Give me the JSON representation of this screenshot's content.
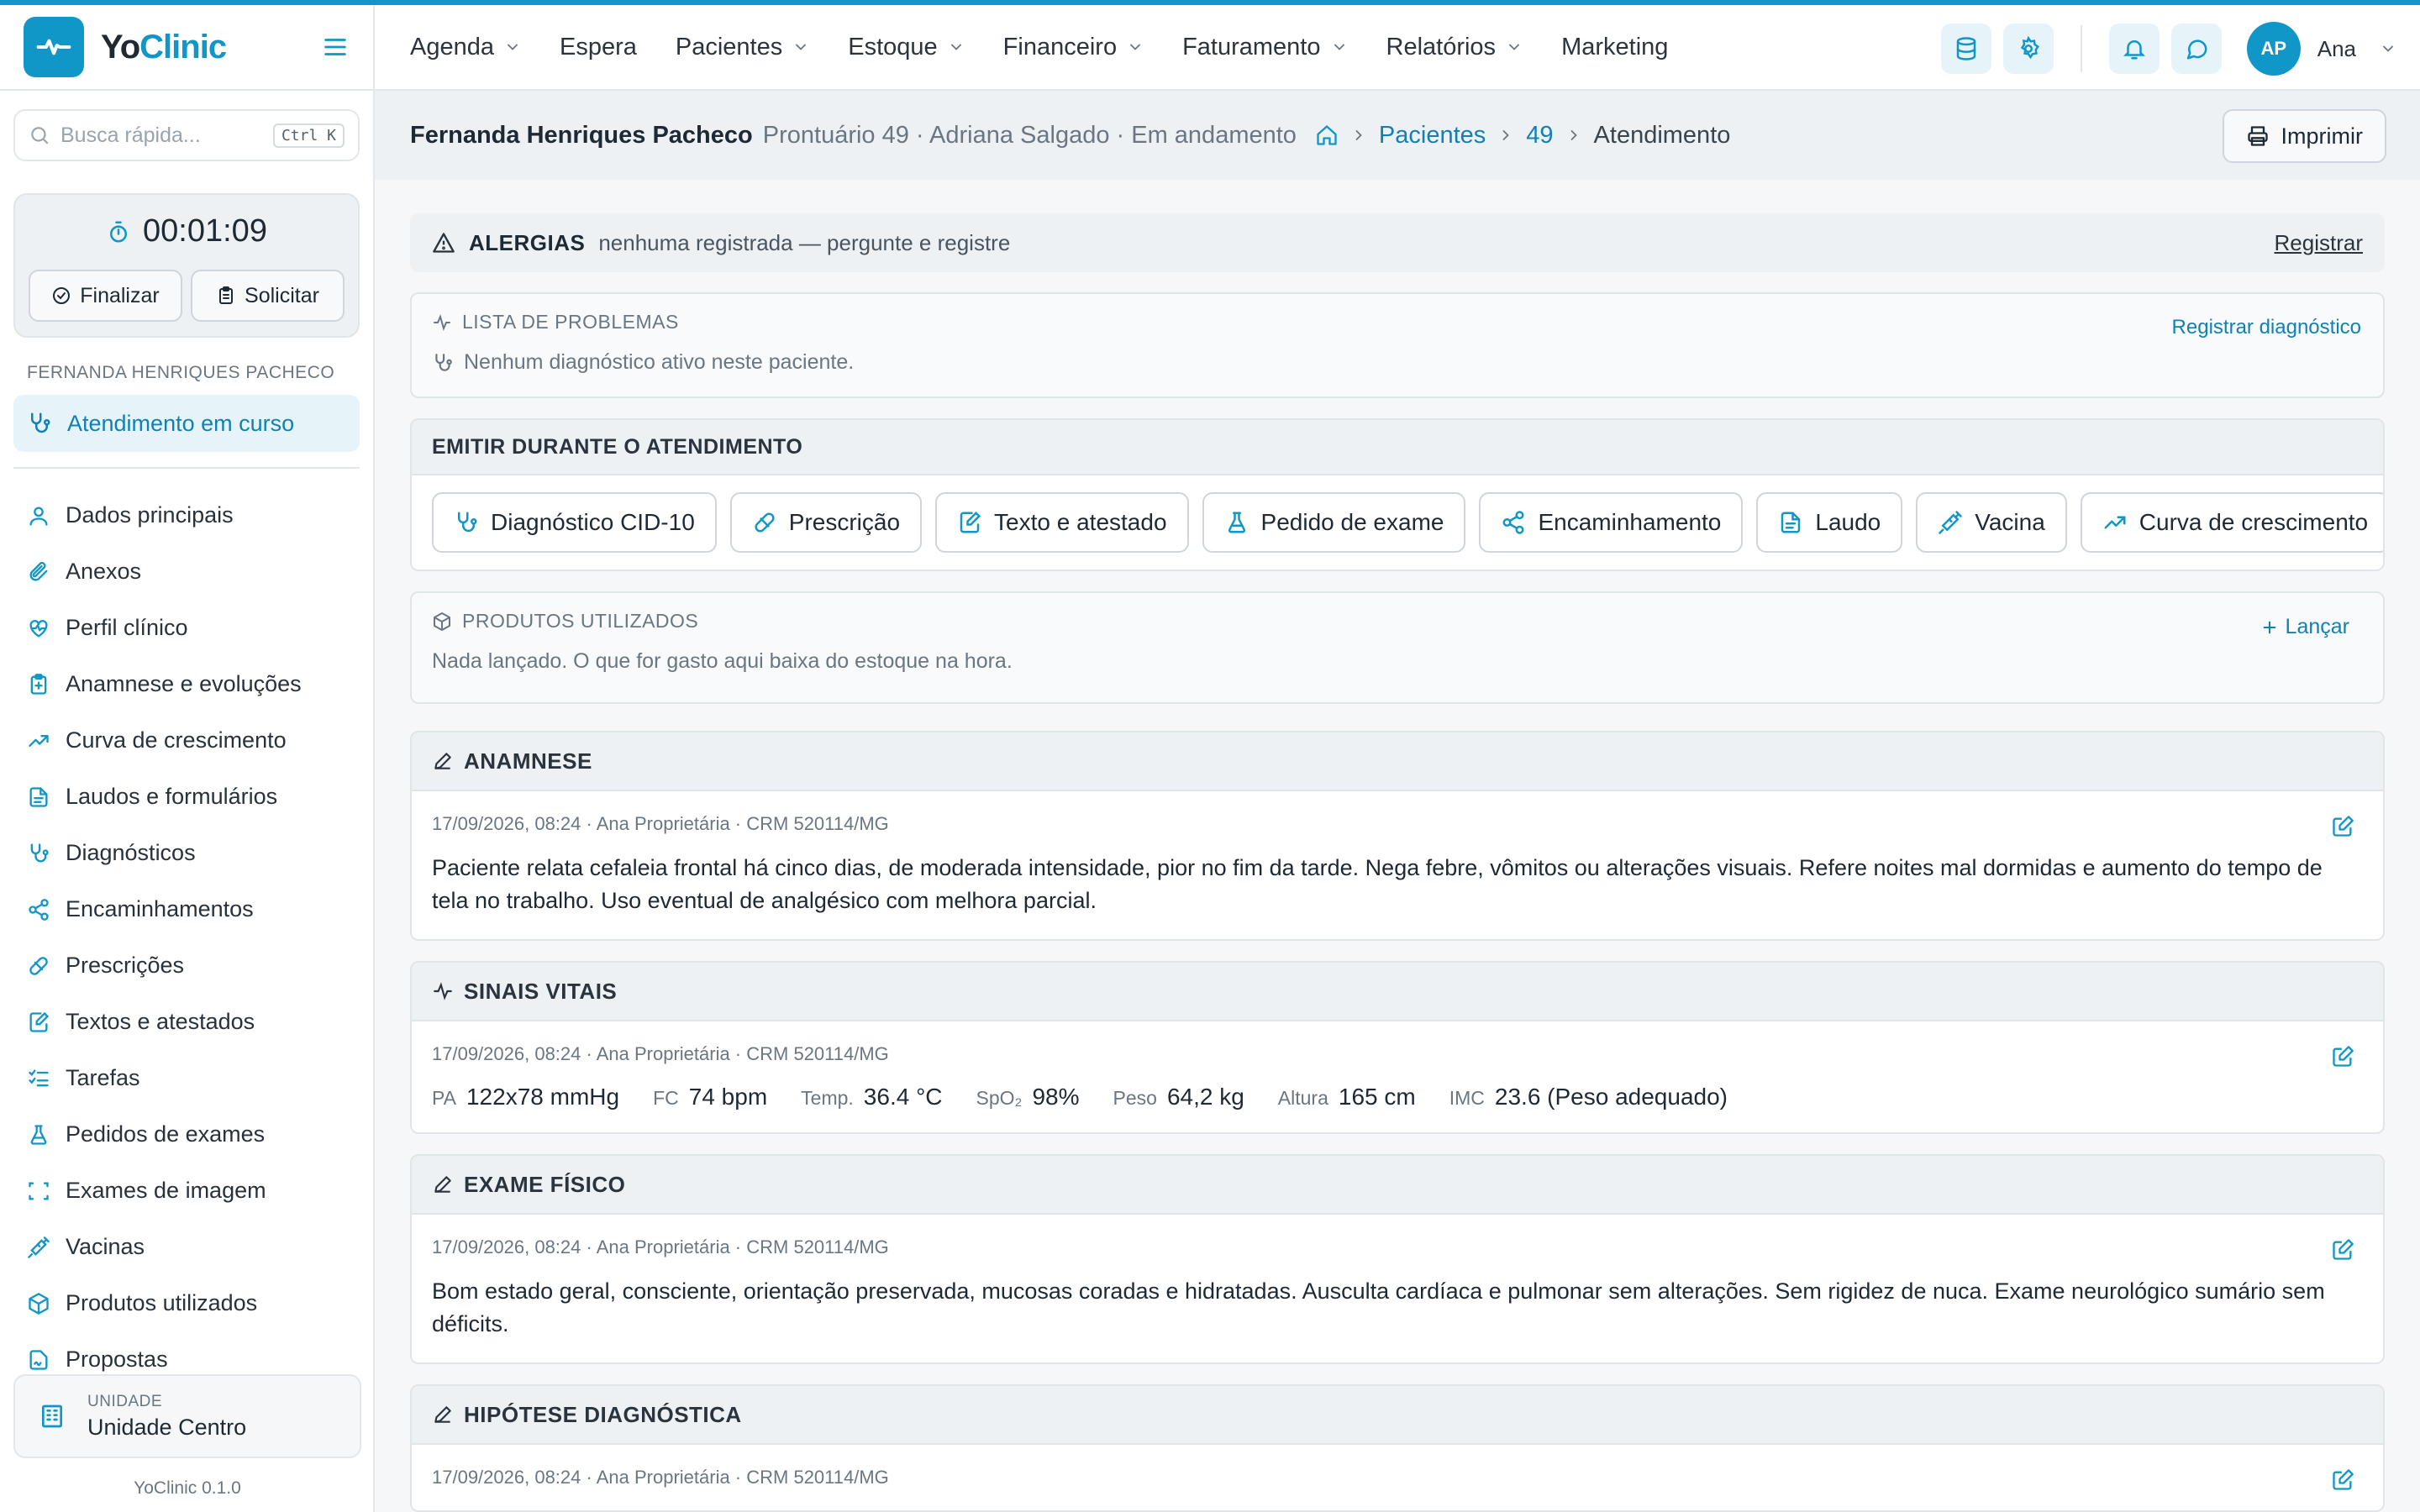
{
  "app": {
    "name_prefix": "Yo",
    "name_suffix": "Clinic",
    "version": "YoClinic 0.1.0"
  },
  "search": {
    "placeholder": "Busca rápida...",
    "shortcut": "Ctrl K"
  },
  "timer": {
    "value": "00:01:09",
    "finish_label": "Finalizar",
    "request_label": "Solicitar"
  },
  "sidebar": {
    "patient_label": "FERNANDA HENRIQUES PACHECO",
    "current_label": "Atendimento em curso",
    "items": [
      {
        "label": "Dados principais",
        "icon": "user-icon"
      },
      {
        "label": "Anexos",
        "icon": "paperclip-icon"
      },
      {
        "label": "Perfil clínico",
        "icon": "heart-pulse-icon"
      },
      {
        "label": "Anamnese e evoluções",
        "icon": "clipboard-plus-icon"
      },
      {
        "label": "Curva de crescimento",
        "icon": "trending-up-icon"
      },
      {
        "label": "Laudos e formulários",
        "icon": "file-text-icon"
      },
      {
        "label": "Diagnósticos",
        "icon": "stethoscope-icon"
      },
      {
        "label": "Encaminhamentos",
        "icon": "share-icon"
      },
      {
        "label": "Prescrições",
        "icon": "pill-icon"
      },
      {
        "label": "Textos e atestados",
        "icon": "file-edit-icon"
      },
      {
        "label": "Tarefas",
        "icon": "list-checks-icon"
      },
      {
        "label": "Pedidos de exames",
        "icon": "flask-icon"
      },
      {
        "label": "Exames de imagem",
        "icon": "scan-icon"
      },
      {
        "label": "Vacinas",
        "icon": "syringe-icon"
      },
      {
        "label": "Produtos utilizados",
        "icon": "package-icon"
      },
      {
        "label": "Propostas",
        "icon": "file-signature-icon"
      }
    ],
    "unit_label": "UNIDADE",
    "unit_value": "Unidade Centro"
  },
  "topnav": {
    "items": [
      {
        "label": "Agenda"
      },
      {
        "label": "Espera"
      },
      {
        "label": "Pacientes"
      },
      {
        "label": "Estoque"
      },
      {
        "label": "Financeiro"
      },
      {
        "label": "Faturamento"
      },
      {
        "label": "Relatórios"
      },
      {
        "label": "Marketing"
      }
    ],
    "avatar_initials": "AP",
    "user_name": "Ana"
  },
  "header": {
    "patient_name": "Fernanda Henriques Pacheco",
    "meta": "Prontuário 49 · Adriana Salgado · Em andamento",
    "crumbs": {
      "patients": "Pacientes",
      "id": "49",
      "current": "Atendimento"
    },
    "print_label": "Imprimir"
  },
  "allergies": {
    "title": "ALERGIAS",
    "message": "nenhuma registrada — pergunte e registre",
    "action": "Registrar"
  },
  "problems": {
    "title": "LISTA DE PROBLEMAS",
    "empty": "Nenhum diagnóstico ativo neste paciente.",
    "action": "Registrar diagnóstico"
  },
  "emit": {
    "title": "EMITIR DURANTE O ATENDIMENTO",
    "buttons": [
      {
        "label": "Diagnóstico CID-10"
      },
      {
        "label": "Prescrição"
      },
      {
        "label": "Texto e atestado"
      },
      {
        "label": "Pedido de exame"
      },
      {
        "label": "Encaminhamento"
      },
      {
        "label": "Laudo"
      },
      {
        "label": "Vacina"
      },
      {
        "label": "Curva de crescimento"
      }
    ]
  },
  "products": {
    "title": "PRODUTOS UTILIZADOS",
    "description": "Nada lançado. O que for gasto aqui baixa do estoque na hora.",
    "action": "Lançar"
  },
  "anamnese": {
    "title": "ANAMNESE",
    "meta": "17/09/2026, 08:24 · Ana Proprietária · CRM 520114/MG",
    "text": "Paciente relata cefaleia frontal há cinco dias, de moderada intensidade, pior no fim da tarde. Nega febre, vômitos ou alterações visuais. Refere noites mal dormidas e aumento do tempo de tela no trabalho. Uso eventual de analgésico com melhora parcial."
  },
  "vitals": {
    "title": "SINAIS VITAIS",
    "meta": "17/09/2026, 08:24 · Ana Proprietária · CRM 520114/MG",
    "items": [
      {
        "key": "PA",
        "value": "122x78 mmHg"
      },
      {
        "key": "FC",
        "value": "74 bpm"
      },
      {
        "key": "Temp.",
        "value": "36.4 °C"
      },
      {
        "key": "SpO₂",
        "value": "98%"
      },
      {
        "key": "Peso",
        "value": "64,2 kg"
      },
      {
        "key": "Altura",
        "value": "165 cm"
      },
      {
        "key": "IMC",
        "value": "23.6 (Peso adequado)"
      }
    ]
  },
  "exam": {
    "title": "EXAME FÍSICO",
    "meta": "17/09/2026, 08:24 · Ana Proprietária · CRM 520114/MG",
    "text": "Bom estado geral, consciente, orientação preservada, mucosas coradas e hidratadas. Ausculta cardíaca e pulmonar sem alterações. Sem rigidez de nuca. Exame neurológico sumário sem déficits."
  },
  "hypothesis": {
    "title": "HIPÓTESE DIAGNÓSTICA",
    "meta": "17/09/2026, 08:24 · Ana Proprietária · CRM 520114/MG"
  },
  "colors": {
    "accent": "#1196c8",
    "link": "#1181b4"
  }
}
